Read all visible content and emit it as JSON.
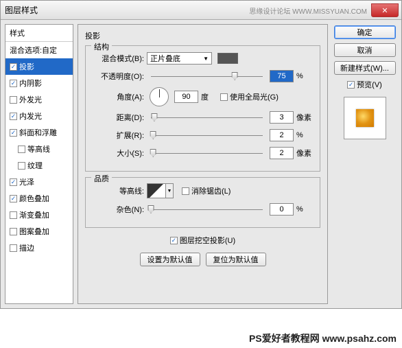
{
  "window": {
    "title": "图层样式",
    "watermark": "思缘设计论坛 WWW.MISSYUAN.COM"
  },
  "left": {
    "header": "样式",
    "blend_opts": "混合选项:自定",
    "items": [
      {
        "label": "投影",
        "checked": true,
        "selected": true
      },
      {
        "label": "内阴影",
        "checked": true
      },
      {
        "label": "外发光",
        "checked": false
      },
      {
        "label": "内发光",
        "checked": true
      },
      {
        "label": "斜面和浮雕",
        "checked": true
      },
      {
        "label": "等高线",
        "checked": false,
        "sub": true
      },
      {
        "label": "纹理",
        "checked": false,
        "sub": true
      },
      {
        "label": "光泽",
        "checked": true
      },
      {
        "label": "颜色叠加",
        "checked": true
      },
      {
        "label": "渐变叠加",
        "checked": false
      },
      {
        "label": "图案叠加",
        "checked": false
      },
      {
        "label": "描边",
        "checked": false
      }
    ]
  },
  "center": {
    "title": "投影",
    "structure_legend": "结构",
    "blend_mode": {
      "label": "混合模式(B):",
      "value": "正片叠底"
    },
    "opacity": {
      "label": "不透明度(O):",
      "value": "75",
      "unit": "%",
      "pos": 75
    },
    "angle": {
      "label": "角度(A):",
      "value": "90",
      "deg": "度",
      "global_label": "使用全局光(G)",
      "global_checked": false
    },
    "distance": {
      "label": "距离(D):",
      "value": "3",
      "unit": "像素",
      "pos": 3
    },
    "spread": {
      "label": "扩展(R):",
      "value": "2",
      "unit": "%",
      "pos": 2
    },
    "size": {
      "label": "大小(S):",
      "value": "2",
      "unit": "像素",
      "pos": 2
    },
    "quality_legend": "品质",
    "contour": {
      "label": "等高线:",
      "antialias_label": "消除锯齿(L)",
      "antialias_checked": false
    },
    "noise": {
      "label": "杂色(N):",
      "value": "0",
      "unit": "%",
      "pos": 0
    },
    "knockout": {
      "label": "图层挖空投影(U)",
      "checked": true
    },
    "default_btn": "设置为默认值",
    "reset_btn": "复位为默认值"
  },
  "right": {
    "ok": "确定",
    "cancel": "取消",
    "new_style": "新建样式(W)...",
    "preview_label": "预览(V)",
    "preview_checked": true
  },
  "footer": "PS爱好者教程网  www.psahz.com"
}
